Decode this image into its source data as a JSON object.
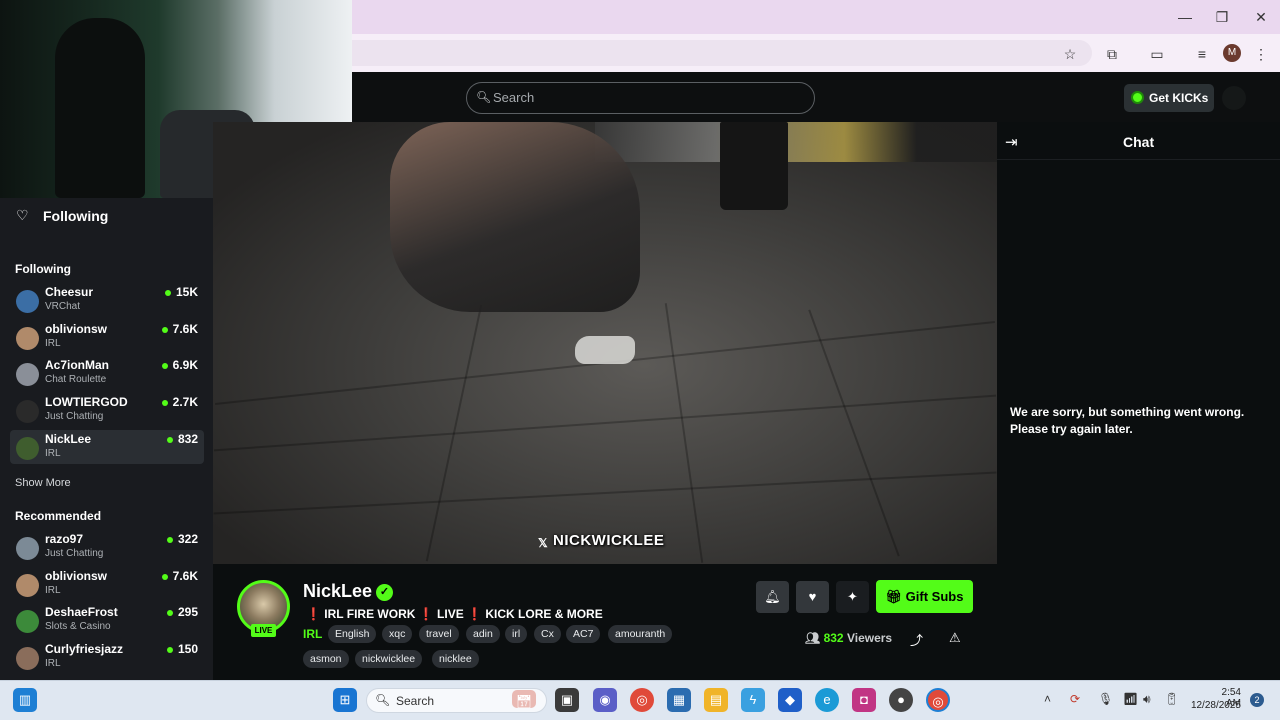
{
  "browser": {
    "window_controls": {
      "minimize": "—",
      "restore": "❐",
      "close": "✕"
    },
    "profile_initial": "M"
  },
  "header": {
    "search_placeholder": "Search",
    "get_kicks_label": "Get KICKs"
  },
  "sidebar": {
    "header_title": "Following",
    "following_title": "Following",
    "following": [
      {
        "name": "Cheesur",
        "category": "VRChat",
        "viewers": "15K",
        "avatar_color": "#3b6ea5"
      },
      {
        "name": "oblivionsw",
        "category": "IRL",
        "viewers": "7.6K",
        "avatar_color": "#b08a6a"
      },
      {
        "name": "Ac7ionMan",
        "category": "Chat Roulette",
        "viewers": "6.9K",
        "avatar_color": "#8a8f98"
      },
      {
        "name": "LOWTIERGOD",
        "category": "Just Chatting",
        "viewers": "2.7K",
        "avatar_color": "#2a2a2a"
      },
      {
        "name": "NickLee",
        "category": "IRL",
        "viewers": "832",
        "avatar_color": "#3f5d2e"
      }
    ],
    "show_more": "Show More",
    "recommended_title": "Recommended",
    "recommended": [
      {
        "name": "razo97",
        "category": "Just Chatting",
        "viewers": "322",
        "avatar_color": "#7c8a96"
      },
      {
        "name": "oblivionsw",
        "category": "IRL",
        "viewers": "7.6K",
        "avatar_color": "#b08a6a"
      },
      {
        "name": "DeshaeFrost",
        "category": "Slots & Casino",
        "viewers": "295",
        "avatar_color": "#3c8a3a"
      },
      {
        "name": "Curlyfriesjazz",
        "category": "IRL",
        "viewers": "150",
        "avatar_color": "#8a6d5b"
      }
    ]
  },
  "video": {
    "watermark_x": "𝕏",
    "watermark": "NICKWICKLEE"
  },
  "stream": {
    "streamer": "NickLee",
    "live_label": "LIVE",
    "title_parts": [
      "IRL FIRE WORK",
      "LIVE",
      "KICK LORE & MORE"
    ],
    "bang": "❗",
    "category": "IRL",
    "tags": [
      "English",
      "xqc",
      "travel",
      "adin",
      "irl",
      "Cx",
      "AC7",
      "amouranth",
      "asmon",
      "nickwicklee",
      "nicklee"
    ],
    "viewers": "832",
    "viewers_label": "Viewers",
    "gift_subs_label": "Gift Subs"
  },
  "chat": {
    "title": "Chat",
    "error_message": "We are sorry, but something went wrong. Please try again later."
  },
  "taskbar": {
    "search_placeholder": "Search",
    "time": "2:54 AM",
    "date": "12/28/2025",
    "notification_count": "2"
  }
}
